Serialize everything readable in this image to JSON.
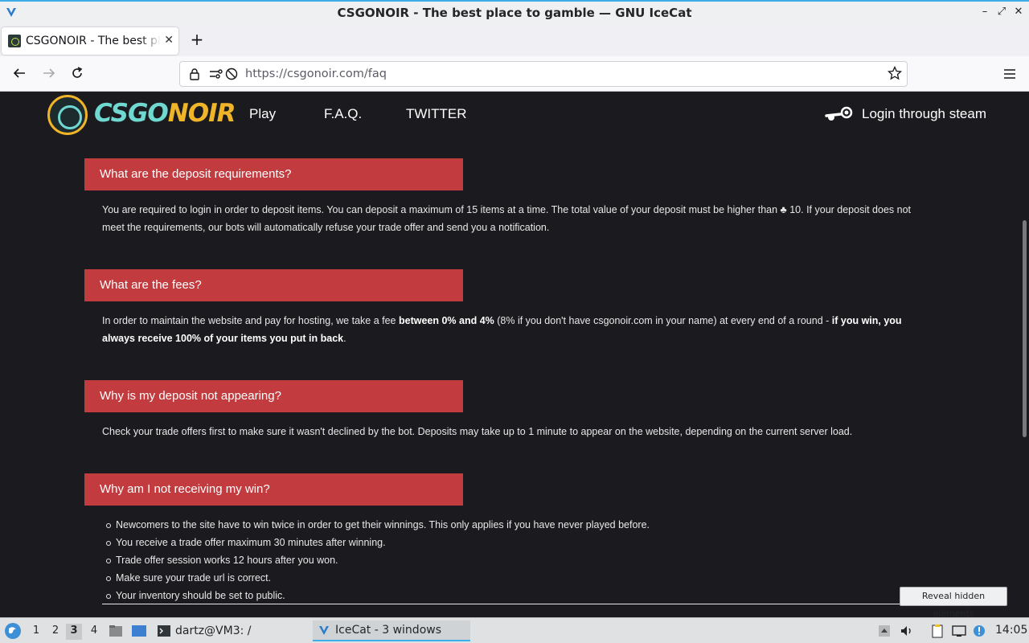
{
  "window": {
    "title": "CSGONOIR - The best place to gamble — GNU IceCat",
    "minimize": "–",
    "maximize": "⤢",
    "close": "✕"
  },
  "browser": {
    "tab_label": "CSGONOIR - The best place to gamble",
    "tab_close": "✕",
    "new_tab": "+",
    "url_host": "https://csgonoir.com",
    "url_path": "/faq"
  },
  "site": {
    "logo_part1": "CSGO",
    "logo_part2": "NOIR",
    "nav": [
      "Play",
      "F.A.Q.",
      "TWITTER"
    ],
    "login_label": "Login through steam"
  },
  "faq": [
    {
      "question": "What are the deposit requirements?",
      "answer": "You are required to login in order to deposit items. You can deposit a maximum of 15 items at a time. The total value of your deposit must be higher than ♣ 10. If your deposit does not meet the requirements, our bots will automatically refuse your trade offer and send you a notification."
    },
    {
      "question": "What are the fees?",
      "answer_parts": [
        "In order to maintain the website and pay for hosting, we take a fee ",
        "between 0% and 4%",
        " (8% if you don't have csgonoir.com in your name) at every end of a round - ",
        "if you win, you always receive 100% of your items you put in back",
        "."
      ]
    },
    {
      "question": "Why is my deposit not appearing?",
      "answer": "Check your trade offers first to make sure it wasn't declined by the bot. Deposits may take up to 1 minute to appear on the website, depending on the current server load."
    },
    {
      "question": "Why am I not receiving my win?",
      "items": [
        "Newcomers to the site have to win twice in order to get their winnings. This only applies if you have never played before.",
        "You receive a trade offer maximum 30 minutes after winning.",
        "Trade offer session works 12 hours after you won.",
        "Make sure your trade url is correct.",
        "Your inventory should be set to public."
      ]
    }
  ],
  "tooltip": "Reveal hidden elements",
  "taskbar": {
    "workspaces": [
      "1",
      "2",
      "3",
      "4"
    ],
    "active_workspace": "3",
    "terminal_task": "dartz@VM3: /",
    "browser_task": "IceCat - 3 windows",
    "clock": "14:05"
  },
  "colors": {
    "accent_red": "#c13b3f",
    "page_bg": "#1b1b1f",
    "logo_teal": "#6fd8d0",
    "logo_gold": "#f0b429"
  }
}
